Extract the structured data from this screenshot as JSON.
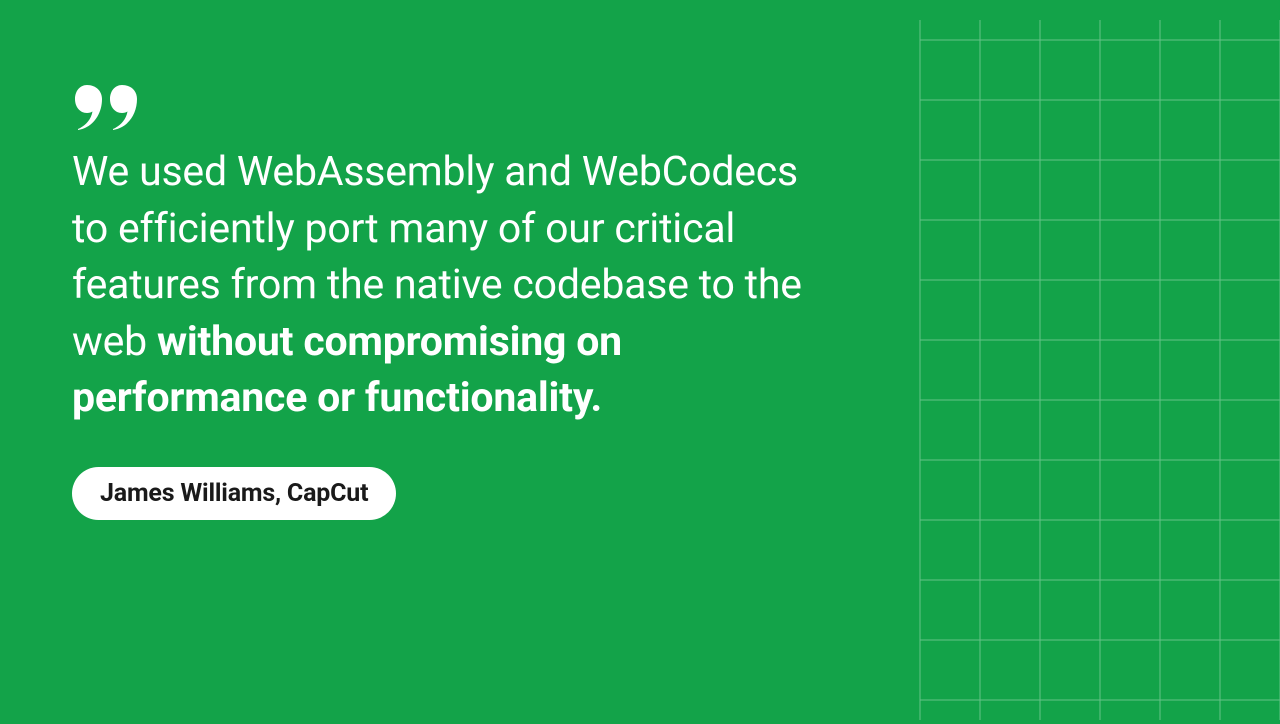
{
  "colors": {
    "background": "#13a349",
    "text": "#ffffff",
    "pill_bg": "#ffffff",
    "pill_text": "#1a1a1a"
  },
  "quote": {
    "regular_part": "We used WebAssembly and WebCodecs to efficiently port many of our critical features from the native codebase to the web ",
    "bold_part": "without compromising on performance or functionality."
  },
  "attribution": "James Williams, CapCut"
}
